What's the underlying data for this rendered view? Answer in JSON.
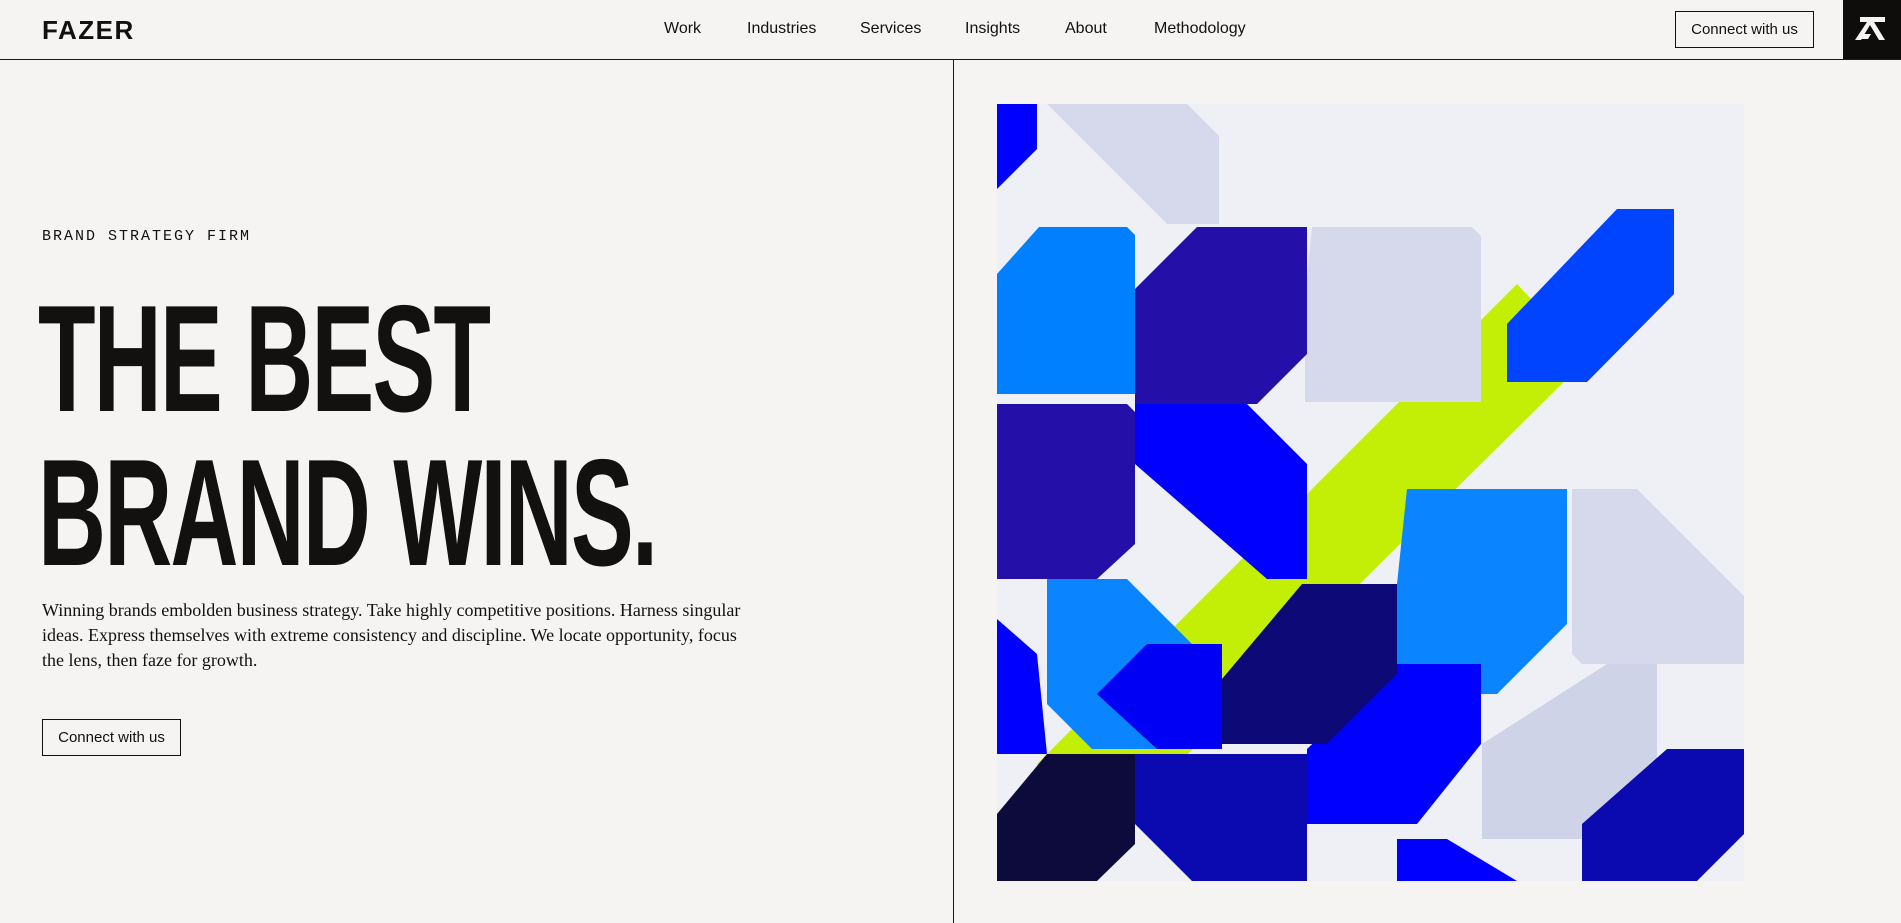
{
  "brand": {
    "name": "FAZER"
  },
  "nav": {
    "items": [
      {
        "label": "Work"
      },
      {
        "label": "Industries"
      },
      {
        "label": "Services"
      },
      {
        "label": "Insights"
      },
      {
        "label": "About"
      },
      {
        "label": "Methodology"
      }
    ],
    "cta_label": "Connect with us",
    "menu_icon": "fazer-monogram-icon"
  },
  "hero": {
    "eyebrow": "BRAND STRATEGY FIRM",
    "headline_line1": "THE BEST",
    "headline_line2": "BRAND WINS.",
    "intro": "Winning brands embolden business strategy. Take highly competitive positions. Harness singular ideas. Express themselves with extreme consistency and discipline. We locate opportunity, focus the lens, then faze for growth.",
    "cta_label": "Connect with us"
  },
  "colors": {
    "background": "#f6f4f2",
    "text": "#111111",
    "art_lime": "#c2ef05",
    "art_electric_blue": "#0000ff",
    "art_sky_blue": "#0080ff",
    "art_indigo": "#2410a8",
    "art_navy": "#0c0b3c",
    "art_lavender": "#d6d8ec"
  }
}
